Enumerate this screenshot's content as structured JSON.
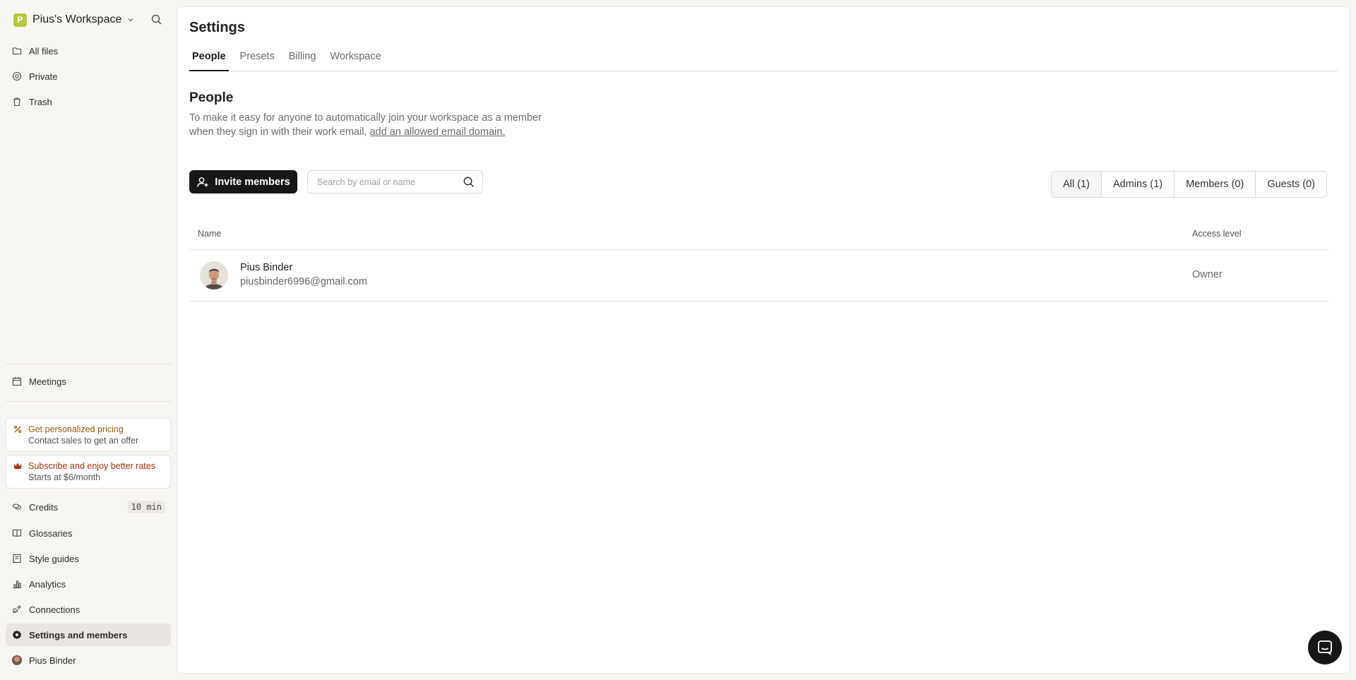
{
  "workspace": {
    "logo_letter": "P",
    "name": "Pius's Workspace"
  },
  "sidebar": {
    "top_items": [
      {
        "label": "All files",
        "icon": "folder-icon"
      },
      {
        "label": "Private",
        "icon": "at-icon"
      },
      {
        "label": "Trash",
        "icon": "trash-icon"
      }
    ],
    "meetings": {
      "label": "Meetings",
      "icon": "calendar-icon"
    },
    "promos": [
      {
        "title": "Get personalized pricing",
        "subtitle": "Contact sales to get an offer",
        "icon": "percent-icon"
      },
      {
        "title": "Subscribe and enjoy better rates",
        "subtitle": "Starts at $6/month",
        "icon": "crown-icon"
      }
    ],
    "credits": {
      "label": "Credits",
      "badge": "10 min",
      "icon": "coins-icon"
    },
    "bottom_items": [
      {
        "label": "Glossaries",
        "icon": "book-icon"
      },
      {
        "label": "Style guides",
        "icon": "style-guide-icon"
      },
      {
        "label": "Analytics",
        "icon": "bar-chart-icon"
      },
      {
        "label": "Connections",
        "icon": "plug-icon"
      },
      {
        "label": "Settings and members",
        "icon": "gear-icon"
      }
    ],
    "user": {
      "label": "Pius Binder",
      "icon": "avatar"
    }
  },
  "page": {
    "title": "Settings",
    "tabs": [
      "People",
      "Presets",
      "Billing",
      "Workspace"
    ],
    "active_tab": "People"
  },
  "people": {
    "title": "People",
    "description": "To make it easy for anyone to automatically join your workspace as a member when they sign in with their work email,",
    "description_link": "add an allowed email domain.",
    "invite_label": "Invite members",
    "search_placeholder": "Search by email or name",
    "filters": [
      "All (1)",
      "Admins (1)",
      "Members (0)",
      "Guests (0)"
    ],
    "active_filter": "All (1)",
    "columns": {
      "name": "Name",
      "access": "Access level"
    },
    "rows": [
      {
        "name": "Pius Binder",
        "email": "piusbinder6996@gmail.com",
        "access": "Owner"
      }
    ]
  },
  "colors": {
    "accent_dark": "#171717",
    "workspace_logo": "#b7c93b",
    "promo_pricing": "#9a5a0c",
    "promo_subscribe": "#a5300c"
  }
}
